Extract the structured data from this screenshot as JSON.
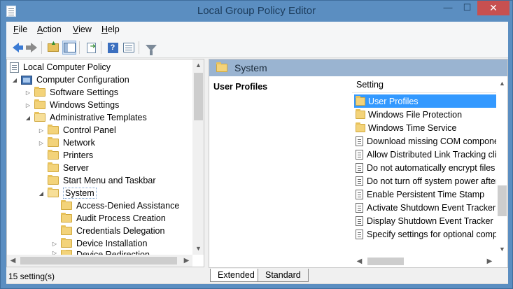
{
  "window": {
    "title": "Local Group Policy Editor",
    "minimize_glyph": "—",
    "maximize_glyph": "☐",
    "close_glyph": "✕"
  },
  "menu": [
    {
      "first": "F",
      "rest": "ile"
    },
    {
      "first": "A",
      "rest": "ction"
    },
    {
      "first": "V",
      "rest": "iew"
    },
    {
      "first": "H",
      "rest": "elp"
    }
  ],
  "toolbar": {
    "icons": [
      "back-arrow-icon",
      "forward-arrow-icon",
      "up-folder-icon",
      "show-hide-tree-icon",
      "export-list-icon",
      "help-icon",
      "properties-icon",
      "filter-icon"
    ]
  },
  "tree": {
    "items": [
      {
        "label": "Local Computer Policy",
        "icon": "policy-icon",
        "expander": ""
      },
      {
        "label": "Computer Configuration",
        "icon": "computer-icon",
        "expander": "◢"
      },
      {
        "label": "Software Settings",
        "icon": "folder-icon",
        "expander": "▷"
      },
      {
        "label": "Windows Settings",
        "icon": "folder-icon",
        "expander": "▷"
      },
      {
        "label": "Administrative Templates",
        "icon": "folder-icon",
        "expander": "◢"
      },
      {
        "label": "Control Panel",
        "icon": "folder-icon",
        "expander": "▷"
      },
      {
        "label": "Network",
        "icon": "folder-icon",
        "expander": "▷"
      },
      {
        "label": "Printers",
        "icon": "folder-icon",
        "expander": ""
      },
      {
        "label": "Server",
        "icon": "folder-icon",
        "expander": ""
      },
      {
        "label": "Start Menu and Taskbar",
        "icon": "folder-icon",
        "expander": ""
      },
      {
        "label": "System",
        "icon": "folder-icon",
        "expander": "◢",
        "selected": true
      },
      {
        "label": "Access-Denied Assistance",
        "icon": "folder-icon",
        "expander": ""
      },
      {
        "label": "Audit Process Creation",
        "icon": "folder-icon",
        "expander": ""
      },
      {
        "label": "Credentials Delegation",
        "icon": "folder-icon",
        "expander": ""
      },
      {
        "label": "Device Installation",
        "icon": "folder-icon",
        "expander": "▷"
      },
      {
        "label": "Device Redirection",
        "icon": "folder-icon",
        "expander": "▷"
      }
    ]
  },
  "right": {
    "header_title": "System",
    "description_title": "User Profiles",
    "column_header": "Setting",
    "rows": [
      {
        "label": "User Profiles",
        "icon": "folder-icon",
        "selected": true
      },
      {
        "label": "Windows File Protection",
        "icon": "folder-icon"
      },
      {
        "label": "Windows Time Service",
        "icon": "folder-icon"
      },
      {
        "label": "Download missing COM components",
        "icon": "setting-icon"
      },
      {
        "label": "Allow Distributed Link Tracking clients",
        "icon": "setting-icon"
      },
      {
        "label": "Do not automatically encrypt files",
        "icon": "setting-icon"
      },
      {
        "label": "Do not turn off system power after",
        "icon": "setting-icon"
      },
      {
        "label": "Enable Persistent Time Stamp",
        "icon": "setting-icon"
      },
      {
        "label": "Activate Shutdown Event Tracker",
        "icon": "setting-icon"
      },
      {
        "label": "Display Shutdown Event Tracker",
        "icon": "setting-icon"
      },
      {
        "label": "Specify settings for optional component",
        "icon": "setting-icon"
      }
    ]
  },
  "tabs": [
    "Extended",
    "Standard"
  ],
  "status": {
    "text": "15 setting(s)"
  },
  "colors": {
    "title_bar": "#5b8ec1",
    "close_button": "#c75050",
    "selection": "#3399ff",
    "pane_header": "#9ab4d1"
  }
}
